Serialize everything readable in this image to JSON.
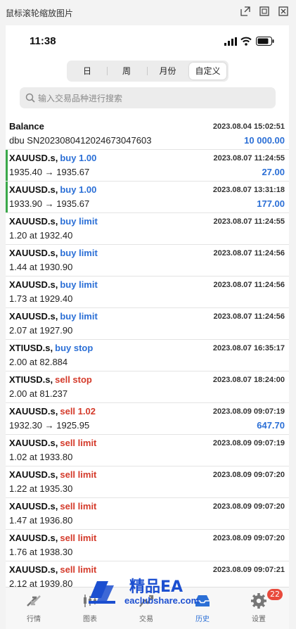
{
  "window": {
    "title": "鼠标滚轮缩放图片"
  },
  "status_bar": {
    "time": "11:38"
  },
  "period_tabs": [
    {
      "label": "日",
      "active": false
    },
    {
      "label": "周",
      "active": false
    },
    {
      "label": "月份",
      "active": false
    },
    {
      "label": "自定义",
      "active": true
    }
  ],
  "search": {
    "placeholder": "输入交易品种进行搜索"
  },
  "rows": [
    {
      "symbol": "Balance",
      "type": "",
      "side": "",
      "line2": "dbu SN20230804120246730476​03",
      "time": "2023.08.04 15:02:51",
      "profit": "10 000.00",
      "marker": false
    },
    {
      "symbol": "XAUUSD.s,",
      "type": "buy 1.00",
      "side": "buy",
      "line2": "1935.40 → 1935.67",
      "time": "2023.08.07 11:24:55",
      "profit": "27.00",
      "marker": true
    },
    {
      "symbol": "XAUUSD.s,",
      "type": "buy 1.00",
      "side": "buy",
      "line2": "1933.90 → 1935.67",
      "time": "2023.08.07 13:31:18",
      "profit": "177.00",
      "marker": true
    },
    {
      "symbol": "XAUUSD.s,",
      "type": "buy limit",
      "side": "buy",
      "line2": "1.20 at 1932.40",
      "time": "2023.08.07 11:24:55",
      "profit": "",
      "marker": false
    },
    {
      "symbol": "XAUUSD.s,",
      "type": "buy limit",
      "side": "buy",
      "line2": "1.44 at 1930.90",
      "time": "2023.08.07 11:24:56",
      "profit": "",
      "marker": false
    },
    {
      "symbol": "XAUUSD.s,",
      "type": "buy limit",
      "side": "buy",
      "line2": "1.73 at 1929.40",
      "time": "2023.08.07 11:24:56",
      "profit": "",
      "marker": false
    },
    {
      "symbol": "XAUUSD.s,",
      "type": "buy limit",
      "side": "buy",
      "line2": "2.07 at 1927.90",
      "time": "2023.08.07 11:24:56",
      "profit": "",
      "marker": false
    },
    {
      "symbol": "XTIUSD.s,",
      "type": "buy stop",
      "side": "buy",
      "line2": "2.00 at 82.884",
      "time": "2023.08.07 16:35:17",
      "profit": "",
      "marker": false
    },
    {
      "symbol": "XTIUSD.s,",
      "type": "sell stop",
      "side": "sell",
      "line2": "2.00 at 81.237",
      "time": "2023.08.07 18:24:00",
      "profit": "",
      "marker": false
    },
    {
      "symbol": "XAUUSD.s,",
      "type": "sell 1.02",
      "side": "sell",
      "line2": "1932.30 → 1925.95",
      "time": "2023.08.09 09:07:19",
      "profit": "647.70",
      "marker": false
    },
    {
      "symbol": "XAUUSD.s,",
      "type": "sell limit",
      "side": "sell",
      "line2": "1.02 at 1933.80",
      "time": "2023.08.09 09:07:19",
      "profit": "",
      "marker": false
    },
    {
      "symbol": "XAUUSD.s,",
      "type": "sell limit",
      "side": "sell",
      "line2": "1.22 at 1935.30",
      "time": "2023.08.09 09:07:20",
      "profit": "",
      "marker": false
    },
    {
      "symbol": "XAUUSD.s,",
      "type": "sell limit",
      "side": "sell",
      "line2": "1.47 at 1936.80",
      "time": "2023.08.09 09:07:20",
      "profit": "",
      "marker": false
    },
    {
      "symbol": "XAUUSD.s,",
      "type": "sell limit",
      "side": "sell",
      "line2": "1.76 at 1938.30",
      "time": "2023.08.09 09:07:20",
      "profit": "",
      "marker": false
    },
    {
      "symbol": "XAUUSD.s,",
      "type": "sell limit",
      "side": "sell",
      "line2": "2.12 at 1939.80",
      "time": "2023.08.09 09:07:21",
      "profit": "",
      "marker": false
    }
  ],
  "tabbar": [
    {
      "label": "行情",
      "icon": "quotes-icon",
      "active": false
    },
    {
      "label": "图表",
      "icon": "chart-icon",
      "active": false
    },
    {
      "label": "交易",
      "icon": "trade-icon",
      "active": false
    },
    {
      "label": "历史",
      "icon": "history-icon",
      "active": true
    },
    {
      "label": "设置",
      "icon": "settings-icon",
      "active": false,
      "badge": "22"
    }
  ],
  "watermark": {
    "title": "精品EA",
    "url": "eaclubshare.com"
  },
  "colors": {
    "buy": "#2b6fd6",
    "sell": "#d43a2a",
    "marker": "#3aa84a",
    "badge": "#e84a3c"
  }
}
